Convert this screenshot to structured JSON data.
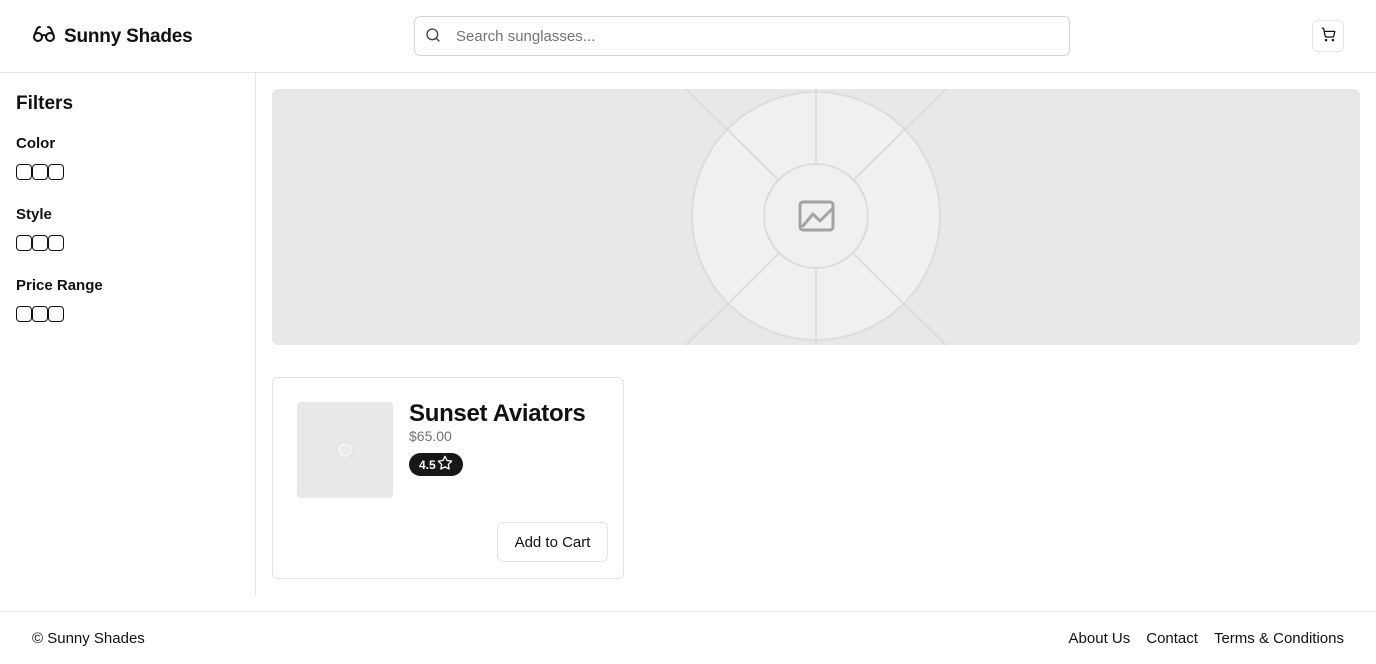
{
  "header": {
    "brand_name": "Sunny Shades",
    "logo_icon": "glasses-icon",
    "search_placeholder": "Search sunglasses...",
    "search_value": "",
    "cart_icon": "shopping-cart-icon"
  },
  "sidebar": {
    "title": "Filters",
    "groups": [
      {
        "label": "Color",
        "options": 3
      },
      {
        "label": "Style",
        "options": 3
      },
      {
        "label": "Price Range",
        "options": 3
      }
    ]
  },
  "hero": {
    "icon": "image-placeholder-icon"
  },
  "products": [
    {
      "name": "Sunset Aviators",
      "price": "$65.00",
      "rating": "4.5",
      "rating_icon": "star-icon",
      "add_to_cart_label": "Add to Cart"
    }
  ],
  "footer": {
    "copyright": "© Sunny Shades",
    "links": [
      "About Us",
      "Contact",
      "Terms & Conditions"
    ]
  },
  "colors": {
    "text": "#111111",
    "muted": "#737373",
    "border": "#e5e5e5",
    "placeholder_bg": "#e8e8e8",
    "badge_bg": "#171717"
  }
}
